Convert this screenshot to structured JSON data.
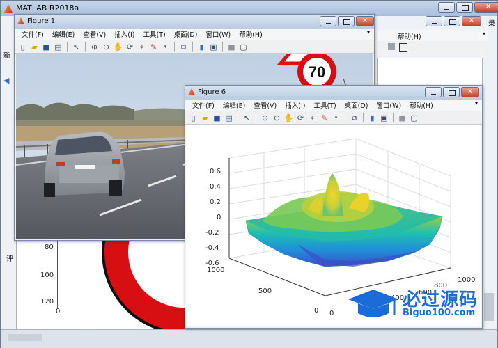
{
  "matlab": {
    "title": "MATLAB R2018a",
    "menu_fragments": [
      "帮助(H)"
    ],
    "left_axis_ticks": [
      "80",
      "100",
      "120"
    ],
    "left_axis_x_tick": "0",
    "search_fragment": "录",
    "left_label_fragment": "评",
    "side_label_fragment": "新"
  },
  "figure1": {
    "title": "Figure 1",
    "menus": [
      "文件(F)",
      "编辑(E)",
      "查看(V)",
      "插入(I)",
      "工具(T)",
      "桌面(D)",
      "窗口(W)",
      "帮助(H)"
    ],
    "sign_text": "70"
  },
  "figure6": {
    "title": "Figure 6",
    "menus": [
      "文件(F)",
      "编辑(E)",
      "查看(V)",
      "插入(I)",
      "工具(T)",
      "桌面(D)",
      "窗口(W)",
      "帮助(H)"
    ]
  },
  "toolbar_icons": [
    "new-file-icon",
    "open-folder-icon",
    "save-icon",
    "print-icon",
    "pointer-icon",
    "zoom-in-icon",
    "zoom-out-icon",
    "pan-icon",
    "rotate3d-icon",
    "data-cursor-icon",
    "brush-icon",
    "link-plot-icon",
    "colorbar-icon",
    "legend-icon",
    "hide-tools-icon",
    "dock-icon"
  ],
  "chart_data": {
    "type": "surface",
    "z_ticks": [
      "0.6",
      "0.4",
      "0.2",
      "0",
      "-0.2",
      "-0.4",
      "-0.6"
    ],
    "y_ticks": [
      "1000",
      "500",
      "0"
    ],
    "x_ticks": [
      "0",
      "200",
      "400",
      "600",
      "800",
      "1000"
    ],
    "zlim": [
      -0.6,
      0.6
    ],
    "xlim": [
      0,
      1000
    ],
    "ylim": [
      0,
      1000
    ],
    "colormap": "parula"
  },
  "watermark": {
    "cn": "必过源码",
    "en": "Biguo100.com"
  }
}
